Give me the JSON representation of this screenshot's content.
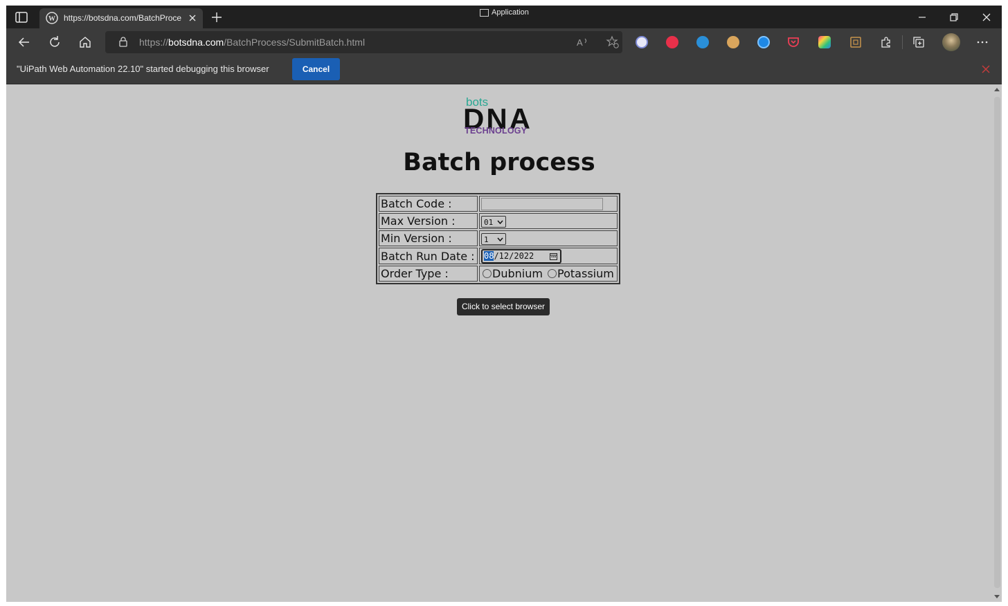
{
  "browser": {
    "tab": {
      "title": "https://botsdna.com/BatchProce",
      "favicon": "wordpress-icon"
    },
    "application_label": "Application",
    "address": {
      "scheme": "https://",
      "host": "botsdna.com",
      "path": "/BatchProcess/SubmitBatch.html"
    }
  },
  "debug_bar": {
    "message": "\"UiPath Web Automation 22.10\" started debugging this browser",
    "cancel_label": "Cancel"
  },
  "page": {
    "logo": {
      "top": "bots",
      "middle": "DNA",
      "bottom": "TECHNOLOGY"
    },
    "title": "Batch process",
    "form": {
      "batch_code_label": "Batch Code :",
      "batch_code_value": "",
      "max_version_label": "Max Version :",
      "max_version_value": "01",
      "min_version_label": "Min Version :",
      "min_version_value": "1",
      "batch_run_date_label": "Batch Run Date :",
      "batch_run_date_month": "08",
      "batch_run_date_rest": "/12/2022",
      "order_type_label": "Order Type :",
      "order_type_options": [
        "Dubnium",
        "Potassium"
      ]
    },
    "tooltip": "Click to select browser"
  }
}
